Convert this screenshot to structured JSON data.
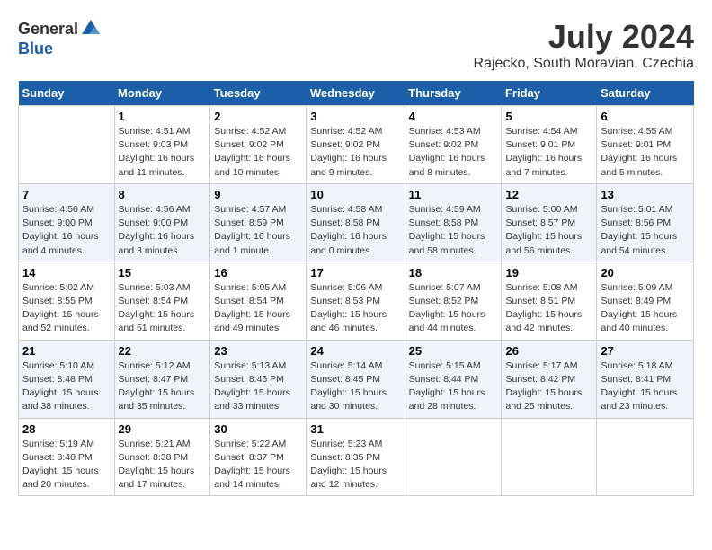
{
  "header": {
    "logo_general": "General",
    "logo_blue": "Blue",
    "month_title": "July 2024",
    "location": "Rajecko, South Moravian, Czechia"
  },
  "days_of_week": [
    "Sunday",
    "Monday",
    "Tuesday",
    "Wednesday",
    "Thursday",
    "Friday",
    "Saturday"
  ],
  "weeks": [
    [
      {
        "day": "",
        "info": ""
      },
      {
        "day": "1",
        "info": "Sunrise: 4:51 AM\nSunset: 9:03 PM\nDaylight: 16 hours\nand 11 minutes."
      },
      {
        "day": "2",
        "info": "Sunrise: 4:52 AM\nSunset: 9:02 PM\nDaylight: 16 hours\nand 10 minutes."
      },
      {
        "day": "3",
        "info": "Sunrise: 4:52 AM\nSunset: 9:02 PM\nDaylight: 16 hours\nand 9 minutes."
      },
      {
        "day": "4",
        "info": "Sunrise: 4:53 AM\nSunset: 9:02 PM\nDaylight: 16 hours\nand 8 minutes."
      },
      {
        "day": "5",
        "info": "Sunrise: 4:54 AM\nSunset: 9:01 PM\nDaylight: 16 hours\nand 7 minutes."
      },
      {
        "day": "6",
        "info": "Sunrise: 4:55 AM\nSunset: 9:01 PM\nDaylight: 16 hours\nand 5 minutes."
      }
    ],
    [
      {
        "day": "7",
        "info": "Sunrise: 4:56 AM\nSunset: 9:00 PM\nDaylight: 16 hours\nand 4 minutes."
      },
      {
        "day": "8",
        "info": "Sunrise: 4:56 AM\nSunset: 9:00 PM\nDaylight: 16 hours\nand 3 minutes."
      },
      {
        "day": "9",
        "info": "Sunrise: 4:57 AM\nSunset: 8:59 PM\nDaylight: 16 hours\nand 1 minute."
      },
      {
        "day": "10",
        "info": "Sunrise: 4:58 AM\nSunset: 8:58 PM\nDaylight: 16 hours\nand 0 minutes."
      },
      {
        "day": "11",
        "info": "Sunrise: 4:59 AM\nSunset: 8:58 PM\nDaylight: 15 hours\nand 58 minutes."
      },
      {
        "day": "12",
        "info": "Sunrise: 5:00 AM\nSunset: 8:57 PM\nDaylight: 15 hours\nand 56 minutes."
      },
      {
        "day": "13",
        "info": "Sunrise: 5:01 AM\nSunset: 8:56 PM\nDaylight: 15 hours\nand 54 minutes."
      }
    ],
    [
      {
        "day": "14",
        "info": "Sunrise: 5:02 AM\nSunset: 8:55 PM\nDaylight: 15 hours\nand 52 minutes."
      },
      {
        "day": "15",
        "info": "Sunrise: 5:03 AM\nSunset: 8:54 PM\nDaylight: 15 hours\nand 51 minutes."
      },
      {
        "day": "16",
        "info": "Sunrise: 5:05 AM\nSunset: 8:54 PM\nDaylight: 15 hours\nand 49 minutes."
      },
      {
        "day": "17",
        "info": "Sunrise: 5:06 AM\nSunset: 8:53 PM\nDaylight: 15 hours\nand 46 minutes."
      },
      {
        "day": "18",
        "info": "Sunrise: 5:07 AM\nSunset: 8:52 PM\nDaylight: 15 hours\nand 44 minutes."
      },
      {
        "day": "19",
        "info": "Sunrise: 5:08 AM\nSunset: 8:51 PM\nDaylight: 15 hours\nand 42 minutes."
      },
      {
        "day": "20",
        "info": "Sunrise: 5:09 AM\nSunset: 8:49 PM\nDaylight: 15 hours\nand 40 minutes."
      }
    ],
    [
      {
        "day": "21",
        "info": "Sunrise: 5:10 AM\nSunset: 8:48 PM\nDaylight: 15 hours\nand 38 minutes."
      },
      {
        "day": "22",
        "info": "Sunrise: 5:12 AM\nSunset: 8:47 PM\nDaylight: 15 hours\nand 35 minutes."
      },
      {
        "day": "23",
        "info": "Sunrise: 5:13 AM\nSunset: 8:46 PM\nDaylight: 15 hours\nand 33 minutes."
      },
      {
        "day": "24",
        "info": "Sunrise: 5:14 AM\nSunset: 8:45 PM\nDaylight: 15 hours\nand 30 minutes."
      },
      {
        "day": "25",
        "info": "Sunrise: 5:15 AM\nSunset: 8:44 PM\nDaylight: 15 hours\nand 28 minutes."
      },
      {
        "day": "26",
        "info": "Sunrise: 5:17 AM\nSunset: 8:42 PM\nDaylight: 15 hours\nand 25 minutes."
      },
      {
        "day": "27",
        "info": "Sunrise: 5:18 AM\nSunset: 8:41 PM\nDaylight: 15 hours\nand 23 minutes."
      }
    ],
    [
      {
        "day": "28",
        "info": "Sunrise: 5:19 AM\nSunset: 8:40 PM\nDaylight: 15 hours\nand 20 minutes."
      },
      {
        "day": "29",
        "info": "Sunrise: 5:21 AM\nSunset: 8:38 PM\nDaylight: 15 hours\nand 17 minutes."
      },
      {
        "day": "30",
        "info": "Sunrise: 5:22 AM\nSunset: 8:37 PM\nDaylight: 15 hours\nand 14 minutes."
      },
      {
        "day": "31",
        "info": "Sunrise: 5:23 AM\nSunset: 8:35 PM\nDaylight: 15 hours\nand 12 minutes."
      },
      {
        "day": "",
        "info": ""
      },
      {
        "day": "",
        "info": ""
      },
      {
        "day": "",
        "info": ""
      }
    ]
  ]
}
